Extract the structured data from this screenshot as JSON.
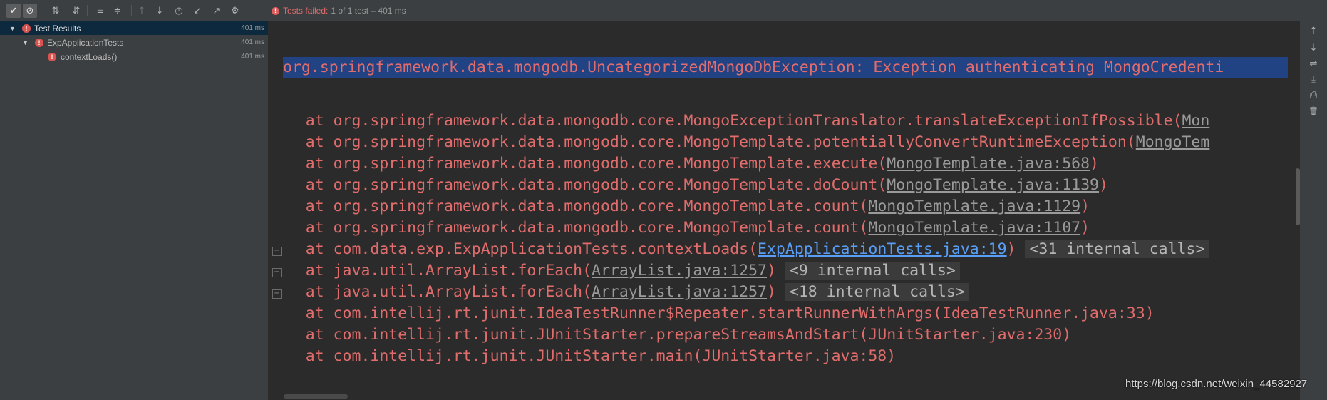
{
  "toolbar": {
    "buttons": [
      {
        "icon": "check-icon",
        "glyph": "✔"
      },
      {
        "icon": "stop-icon",
        "glyph": "⊘"
      },
      {
        "icon": "sort-alpha-icon",
        "glyph": "⇅"
      },
      {
        "icon": "sort-duration-icon",
        "glyph": "⇵"
      },
      {
        "icon": "expand-all-icon",
        "glyph": "≡"
      },
      {
        "icon": "collapse-all-icon",
        "glyph": "≑"
      },
      {
        "icon": "previous-failed-icon",
        "glyph": "↑"
      },
      {
        "icon": "next-failed-icon",
        "glyph": "↓"
      },
      {
        "icon": "history-icon",
        "glyph": "◷"
      },
      {
        "icon": "import-tests-icon",
        "glyph": "↙"
      },
      {
        "icon": "export-tests-icon",
        "glyph": "↗"
      },
      {
        "icon": "settings-icon",
        "glyph": "⚙"
      }
    ],
    "status_failed": "Tests failed:",
    "status_rest": "1 of 1 test – 401 ms"
  },
  "tree": {
    "items": [
      {
        "label": "Test Results",
        "time": "401 ms",
        "level": 0
      },
      {
        "label": "ExpApplicationTests",
        "time": "401 ms",
        "level": 1
      },
      {
        "label": "contextLoads()",
        "time": "401 ms",
        "level": 2
      }
    ]
  },
  "console": {
    "exception": "org.springframework.data.mongodb.UncategorizedMongoDbException: Exception authenticating MongoCredenti",
    "frames": [
      {
        "text": "    at org.springframework.data.mongodb.core.MongoExceptionTranslator.translateExceptionIfPossible(",
        "link": "Mon",
        "tail": "",
        "internal": ""
      },
      {
        "text": "    at org.springframework.data.mongodb.core.MongoTemplate.potentiallyConvertRuntimeException(",
        "link": "MongoTem",
        "tail": "",
        "internal": ""
      },
      {
        "text": "    at org.springframework.data.mongodb.core.MongoTemplate.execute(",
        "link": "MongoTemplate.java:568",
        "tail": ")",
        "internal": ""
      },
      {
        "text": "    at org.springframework.data.mongodb.core.MongoTemplate.doCount(",
        "link": "MongoTemplate.java:1139",
        "tail": ")",
        "internal": ""
      },
      {
        "text": "    at org.springframework.data.mongodb.core.MongoTemplate.count(",
        "link": "MongoTemplate.java:1129",
        "tail": ")",
        "internal": ""
      },
      {
        "text": "    at org.springframework.data.mongodb.core.MongoTemplate.count(",
        "link": "MongoTemplate.java:1107",
        "tail": ")",
        "internal": ""
      },
      {
        "text": "    at com.data.exp.ExpApplicationTests.contextLoads(",
        "link": "ExpApplicationTests.java:19",
        "tail": ")",
        "internal": "<31 internal calls>",
        "blue": true
      },
      {
        "text": "    at java.util.ArrayList.forEach(",
        "link": "ArrayList.java:1257",
        "tail": ")",
        "internal": "<9 internal calls>"
      },
      {
        "text": "    at java.util.ArrayList.forEach(",
        "link": "ArrayList.java:1257",
        "tail": ")",
        "internal": "<18 internal calls>"
      },
      {
        "text": "    at com.intellij.rt.junit.IdeaTestRunner$Repeater.startRunnerWithArgs(IdeaTestRunner.java:33)",
        "link": "",
        "tail": "",
        "internal": ""
      },
      {
        "text": "    at com.intellij.rt.junit.JUnitStarter.prepareStreamsAndStart(JUnitStarter.java:230)",
        "link": "",
        "tail": "",
        "internal": ""
      },
      {
        "text": "    at com.intellij.rt.junit.JUnitStarter.main(JUnitStarter.java:58)",
        "link": "",
        "tail": "",
        "internal": ""
      }
    ]
  },
  "rightbar": [
    {
      "icon": "scroll-up-icon",
      "glyph": "↑"
    },
    {
      "icon": "scroll-down-icon",
      "glyph": "↓"
    },
    {
      "icon": "soft-wrap-icon",
      "glyph": "⇌"
    },
    {
      "icon": "scroll-to-end-icon",
      "glyph": "⤓"
    },
    {
      "icon": "print-icon",
      "glyph": "⎙"
    },
    {
      "icon": "clear-all-icon",
      "glyph": "🗑"
    }
  ],
  "watermark": "https://blog.csdn.net/weixin_44582927",
  "colors": {
    "error": "#e06c6c",
    "selection": "#214283",
    "link_blue": "#589df6"
  }
}
